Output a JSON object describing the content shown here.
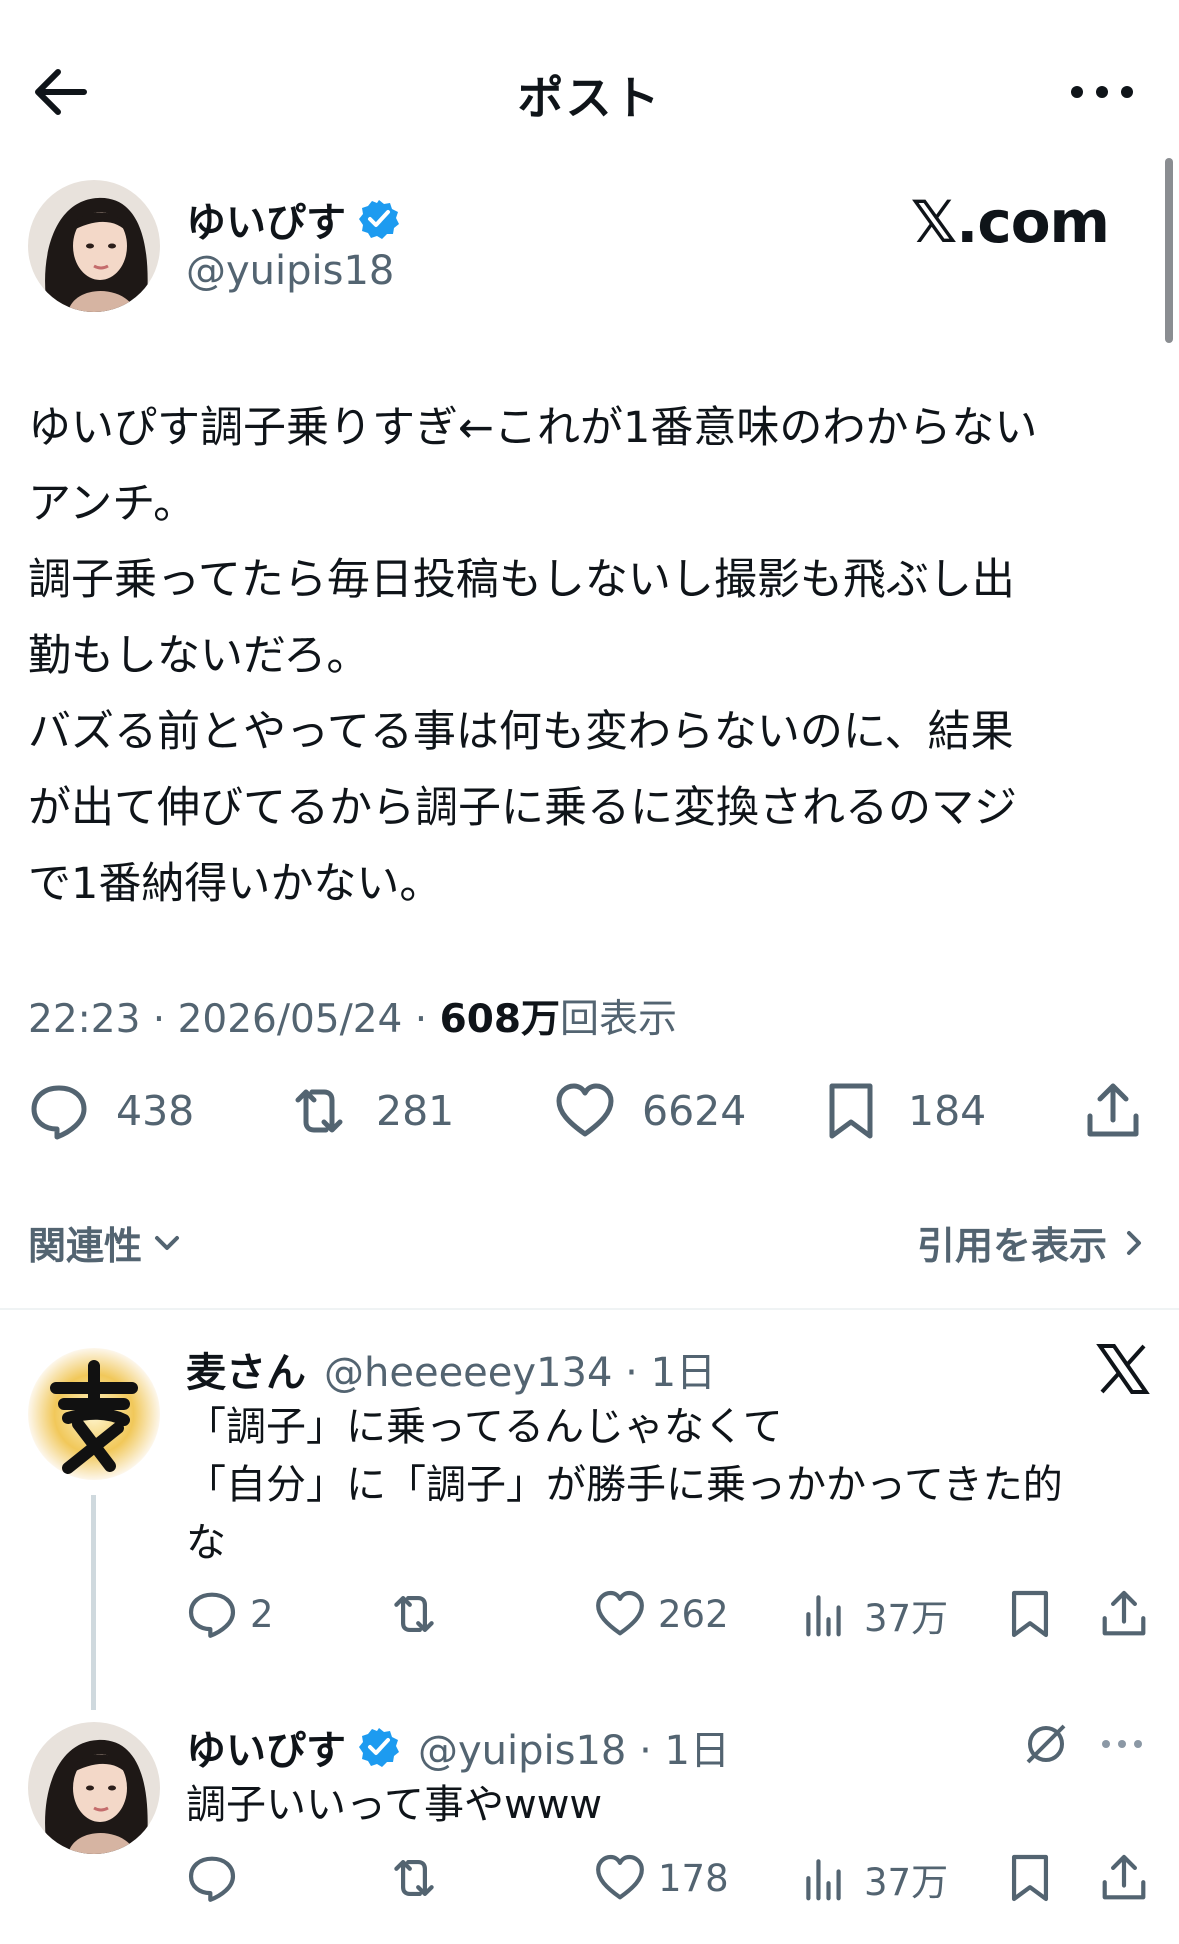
{
  "header": {
    "title": "ポスト"
  },
  "post": {
    "author_name": "ゆいぴす",
    "author_handle": "@yuipis18",
    "brand": "𝕏.com",
    "text": "ゆいぴす調子乗りすぎ←これが1番意味のわからない\nアンチ。\n調子乗ってたら毎日投稿もしないし撮影も飛ぶし出\n勤もしないだろ。\nバズる前とやってる事は何も変わらないのに、結果\nが出て伸びてるから調子に乗るに変換されるのマジ\nで1番納得いかない。",
    "timestamp": "22:23 · 2026/05/24 · ",
    "views_value": "608万",
    "views_label": "回表示",
    "replies": "438",
    "reposts": "281",
    "likes": "6624",
    "bookmarks": "184"
  },
  "sort_label": "関連性",
  "quotes_label": "引用を表示",
  "replies": [
    {
      "name": "麦さん",
      "handle": "@heeeeey134 · 1日",
      "text": "「調子」に乗ってるんじゃなくて\n「自分」に「調子」が勝手に乗っかかってきた的\nな",
      "replies": "2",
      "reposts": "",
      "likes": "262",
      "views": "37万"
    },
    {
      "name": "ゆいぴす",
      "handle": "@yuipis18 · 1日",
      "text": "調子いいって事やwww",
      "replies": "",
      "reposts": "",
      "likes": "178",
      "views": "37万"
    }
  ],
  "colors": {
    "text": "#0f1419",
    "secondary": "#536471",
    "verified": "#1d9bf0",
    "divider": "#eff3f4"
  },
  "icons": [
    "back-arrow-icon",
    "more-icon",
    "verified-badge-icon",
    "reply-icon",
    "repost-icon",
    "like-icon",
    "bookmark-icon",
    "share-icon",
    "views-icon",
    "x-logo-icon",
    "grok-icon",
    "chevron-down-icon",
    "chevron-right-icon"
  ]
}
